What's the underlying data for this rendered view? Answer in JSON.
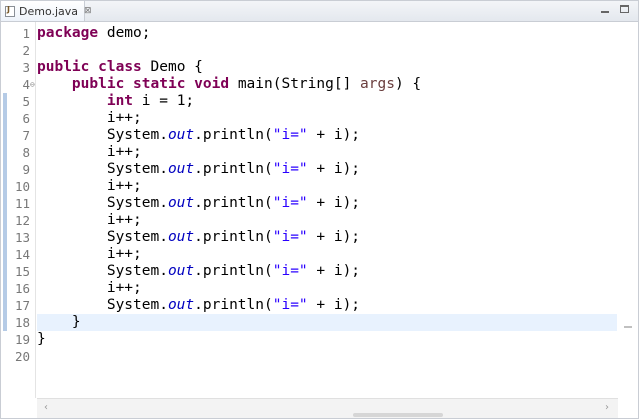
{
  "editor_tab": {
    "label": "Demo.java",
    "icon": "java-file-icon",
    "close_glyph": "⊠"
  },
  "scrollbar": {
    "left_glyph": "‹",
    "right_glyph": "›"
  },
  "colors": {
    "keyword": "#7f0055",
    "string": "#2a00ff",
    "static_field": "#0000c0",
    "parameter": "#6a3e3e",
    "current_line": "#e8f2fe",
    "change_bar": "#b5cbe6"
  },
  "current_line": 18,
  "lines": [
    {
      "num": "1",
      "tokens": [
        {
          "t": "package",
          "c": "kw"
        },
        {
          "t": " demo;"
        }
      ]
    },
    {
      "num": "2",
      "tokens": []
    },
    {
      "num": "3",
      "tokens": [
        {
          "t": "public",
          "c": "kw"
        },
        {
          "t": " "
        },
        {
          "t": "class",
          "c": "kw"
        },
        {
          "t": " Demo {"
        }
      ]
    },
    {
      "num": "4",
      "fold": "⊖",
      "tokens": [
        {
          "t": "    "
        },
        {
          "t": "public",
          "c": "kw"
        },
        {
          "t": " "
        },
        {
          "t": "static",
          "c": "kw"
        },
        {
          "t": " "
        },
        {
          "t": "void",
          "c": "kw"
        },
        {
          "t": " main(String[] "
        },
        {
          "t": "args",
          "c": "param"
        },
        {
          "t": ") {"
        }
      ]
    },
    {
      "num": "5",
      "tokens": [
        {
          "t": "        "
        },
        {
          "t": "int",
          "c": "kw"
        },
        {
          "t": " i = 1;"
        }
      ]
    },
    {
      "num": "6",
      "tokens": [
        {
          "t": "        i++;"
        }
      ]
    },
    {
      "num": "7",
      "tokens": [
        {
          "t": "        System."
        },
        {
          "t": "out",
          "c": "static-field"
        },
        {
          "t": ".println("
        },
        {
          "t": "\"i=\"",
          "c": "str"
        },
        {
          "t": " + i);"
        }
      ]
    },
    {
      "num": "8",
      "tokens": [
        {
          "t": "        i++;"
        }
      ]
    },
    {
      "num": "9",
      "tokens": [
        {
          "t": "        System."
        },
        {
          "t": "out",
          "c": "static-field"
        },
        {
          "t": ".println("
        },
        {
          "t": "\"i=\"",
          "c": "str"
        },
        {
          "t": " + i);"
        }
      ]
    },
    {
      "num": "10",
      "tokens": [
        {
          "t": "        i++;"
        }
      ]
    },
    {
      "num": "11",
      "tokens": [
        {
          "t": "        System."
        },
        {
          "t": "out",
          "c": "static-field"
        },
        {
          "t": ".println("
        },
        {
          "t": "\"i=\"",
          "c": "str"
        },
        {
          "t": " + i);"
        }
      ]
    },
    {
      "num": "12",
      "tokens": [
        {
          "t": "        i++;"
        }
      ]
    },
    {
      "num": "13",
      "tokens": [
        {
          "t": "        System."
        },
        {
          "t": "out",
          "c": "static-field"
        },
        {
          "t": ".println("
        },
        {
          "t": "\"i=\"",
          "c": "str"
        },
        {
          "t": " + i);"
        }
      ]
    },
    {
      "num": "14",
      "tokens": [
        {
          "t": "        i++;"
        }
      ]
    },
    {
      "num": "15",
      "tokens": [
        {
          "t": "        System."
        },
        {
          "t": "out",
          "c": "static-field"
        },
        {
          "t": ".println("
        },
        {
          "t": "\"i=\"",
          "c": "str"
        },
        {
          "t": " + i);"
        }
      ]
    },
    {
      "num": "16",
      "tokens": [
        {
          "t": "        i++;"
        }
      ]
    },
    {
      "num": "17",
      "tokens": [
        {
          "t": "        System."
        },
        {
          "t": "out",
          "c": "static-field"
        },
        {
          "t": ".println("
        },
        {
          "t": "\"i=\"",
          "c": "str"
        },
        {
          "t": " + i);"
        }
      ]
    },
    {
      "num": "18",
      "tokens": [
        {
          "t": "    }"
        }
      ]
    },
    {
      "num": "19",
      "tokens": [
        {
          "t": "}"
        }
      ]
    },
    {
      "num": "20",
      "tokens": []
    }
  ]
}
